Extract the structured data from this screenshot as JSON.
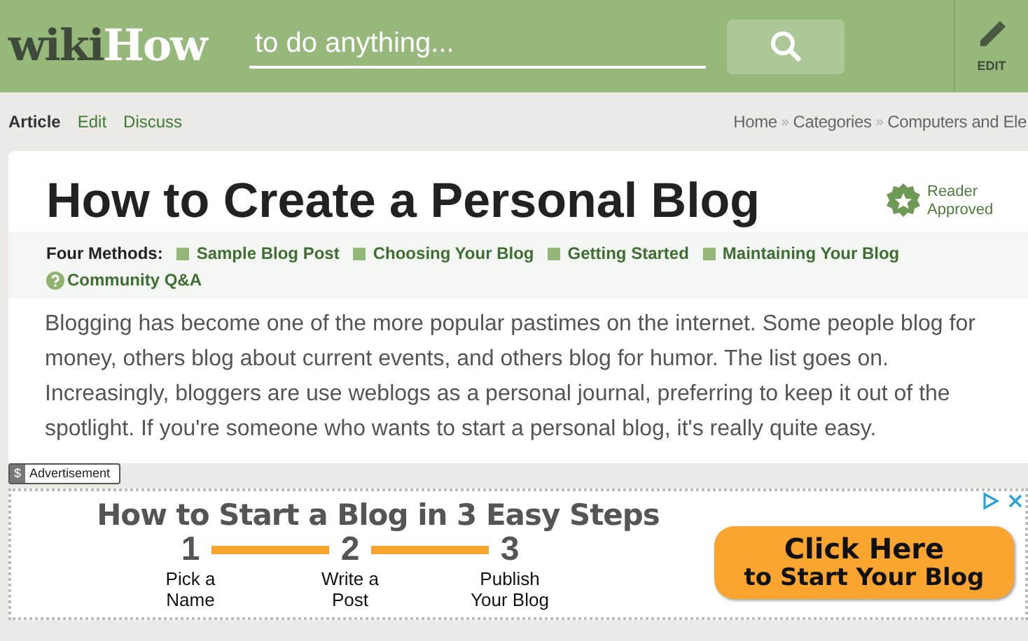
{
  "header": {
    "logo": {
      "part_1": "wiki",
      "part_2": "How"
    },
    "search": {
      "placeholder": "to do anything..."
    },
    "edit_label": "EDIT"
  },
  "tabs": [
    {
      "label": "Article",
      "selected": true
    },
    {
      "label": "Edit",
      "selected": false
    },
    {
      "label": "Discuss",
      "selected": false
    }
  ],
  "breadcrumb": {
    "items": [
      "Home",
      "Categories",
      "Computers and Ele"
    ],
    "separator": "»"
  },
  "article": {
    "title": "How to Create a Personal Blog",
    "badge": "Reader Approved",
    "methods_label": "Four Methods:",
    "methods": [
      {
        "label": "Sample Blog Post",
        "kind": "method"
      },
      {
        "label": "Choosing Your Blog",
        "kind": "method"
      },
      {
        "label": "Getting Started",
        "kind": "method"
      },
      {
        "label": "Maintaining Your Blog",
        "kind": "method"
      },
      {
        "label": "Community Q&A",
        "kind": "qa"
      }
    ],
    "intro": "Blogging has become one of the more popular pastimes on the internet. Some people blog for money, others blog about current events, and others blog for humor. The list goes on. Increasingly, bloggers are use weblogs as a personal journal, preferring to keep it out of the spotlight. If you're someone who wants to start a personal blog, it's really quite easy."
  },
  "ad": {
    "icon_letter": "$",
    "label": "Advertisement",
    "headline": "How to Start a Blog in 3 Easy Steps",
    "steps": [
      {
        "number": "1",
        "caption": "Pick a Name"
      },
      {
        "number": "2",
        "caption": "Write a Post"
      },
      {
        "number": "3",
        "caption": "Publish Your Blog"
      }
    ],
    "cta": {
      "line_1": "Click Here",
      "line_2": "to Start Your Blog"
    }
  }
}
